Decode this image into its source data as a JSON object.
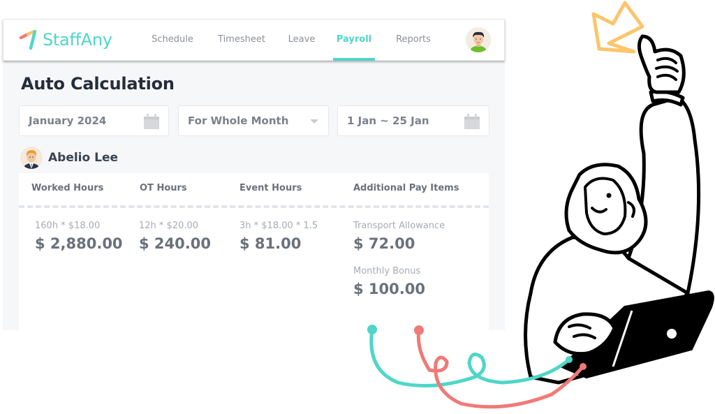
{
  "brand": {
    "name": "StaffAny",
    "accent_color": "#4fd6c8"
  },
  "nav": {
    "items": [
      {
        "label": "Schedule",
        "active": false
      },
      {
        "label": "Timesheet",
        "active": false
      },
      {
        "label": "Leave",
        "active": false
      },
      {
        "label": "Payroll",
        "active": true
      },
      {
        "label": "Reports",
        "active": false
      }
    ],
    "user_avatar": "user-avatar-icon"
  },
  "page": {
    "title": "Auto Calculation"
  },
  "filters": {
    "month": "January 2024",
    "period": "For Whole Month",
    "date_range": "1 Jan ~ 25 Jan"
  },
  "employee": {
    "name": "Abelio Lee"
  },
  "columns": [
    {
      "header": "Worked Hours",
      "items": [
        {
          "detail": "160h * $18.00",
          "amount": "$ 2,880.00"
        }
      ]
    },
    {
      "header": "OT Hours",
      "items": [
        {
          "detail": "12h * $20.00",
          "amount": "$ 240.00"
        }
      ]
    },
    {
      "header": "Event Hours",
      "items": [
        {
          "detail": "3h * $18.00 * 1.5",
          "amount": "$ 81.00"
        }
      ]
    },
    {
      "header": "Additional Pay Items",
      "items": [
        {
          "detail": "Transport Allowance",
          "amount": "$ 72.00"
        },
        {
          "detail": "Monthly Bonus",
          "amount": "$ 100.00"
        }
      ]
    }
  ],
  "colors": {
    "teal": "#4fd6c8",
    "coral": "#ef7a78",
    "star": "#fbc56a",
    "ink": "#000000"
  }
}
